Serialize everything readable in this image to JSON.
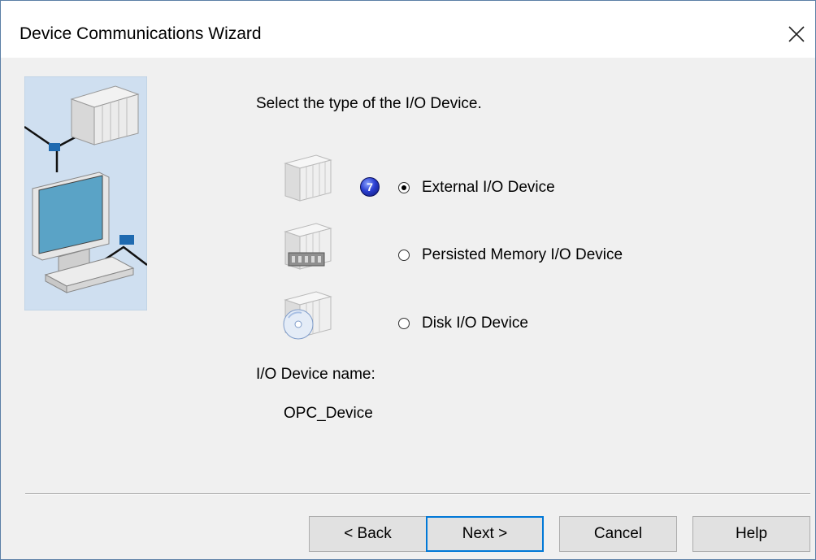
{
  "window": {
    "title": "Device Communications Wizard"
  },
  "main": {
    "prompt": "Select the type of the I/O Device.",
    "help_badge": "7",
    "options": [
      {
        "label": "External I/O Device",
        "selected": true,
        "icon": "io-rack-icon"
      },
      {
        "label": "Persisted Memory I/O Device",
        "selected": false,
        "icon": "memory-io-icon"
      },
      {
        "label": "Disk I/O Device",
        "selected": false,
        "icon": "disk-io-icon"
      }
    ],
    "device_name_label": "I/O Device name:",
    "device_name_value": "OPC_Device"
  },
  "buttons": {
    "back": "< Back",
    "next": "Next >",
    "cancel": "Cancel",
    "help": "Help"
  },
  "colors": {
    "accent": "#0078d7",
    "dialog_bg": "#f0f0f0",
    "art_bg": "#cfdff0"
  }
}
